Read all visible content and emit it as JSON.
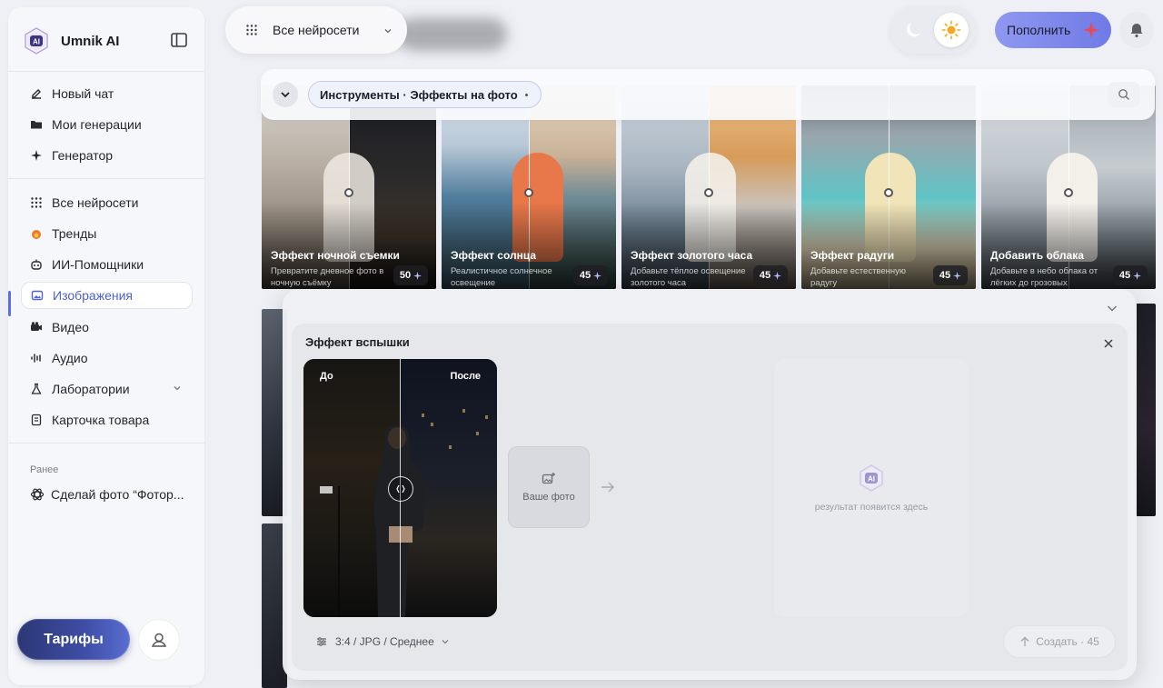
{
  "app": {
    "name": "Umnik AI"
  },
  "sidebar": {
    "primary": [
      {
        "label": "Новый чат",
        "icon": "pencil-icon"
      },
      {
        "label": "Мои генерации",
        "icon": "folder-icon"
      },
      {
        "label": "Генератор",
        "icon": "sparkle-icon"
      }
    ],
    "sections": [
      {
        "label": "Все нейросети",
        "icon": "grid-dots-icon"
      },
      {
        "label": "Тренды",
        "icon": "fire-icon"
      },
      {
        "label": "ИИ-Помощники",
        "icon": "robot-icon"
      },
      {
        "label": "Изображения",
        "icon": "image-icon",
        "active": true
      },
      {
        "label": "Видео",
        "icon": "video-icon"
      },
      {
        "label": "Аудио",
        "icon": "audio-wave-icon"
      },
      {
        "label": "Лаборатории",
        "icon": "flask-icon"
      },
      {
        "label": "Карточка товара",
        "icon": "card-icon"
      }
    ],
    "earlier_label": "Ранее",
    "earlier_items": [
      {
        "label": "Сделай фото “Фотор...",
        "icon": "chatgpt-icon"
      }
    ],
    "tariffs_label": "Тарифы"
  },
  "topbar": {
    "model_select": "Все нейросети",
    "topup_label": "Пополнить",
    "theme": "light"
  },
  "tools": {
    "breadcrumb": "Инструменты · Эффекты на фото"
  },
  "cards": [
    {
      "title": "Эффект ночной съемки",
      "desc": "Превратите дневное фото в ночную съёмку",
      "price": "50"
    },
    {
      "title": "Эффект солнца",
      "desc": "Реалистичное солнечное освещение",
      "price": "45"
    },
    {
      "title": "Эффект золотого часа",
      "desc": "Добавьте тёплое освещение золотого часа",
      "price": "45"
    },
    {
      "title": "Эффект радуги",
      "desc": "Добавьте естественную радугу",
      "price": "45"
    },
    {
      "title": "Добавить облака",
      "desc": "Добавьте в небо облака от лёгких до грозовых",
      "price": "45"
    }
  ],
  "modal": {
    "title": "Эффект вспышки",
    "before_label": "До",
    "after_label": "После",
    "upload_label": "Ваше фото",
    "result_placeholder": "результат появится здесь",
    "format": "3:4 / JPG / Среднее",
    "create_label": "Создать · 45"
  },
  "colors": {
    "accent": "#5f6fe0",
    "tariffs_button": "#2c3774",
    "topup_button": "#7b85ea"
  }
}
